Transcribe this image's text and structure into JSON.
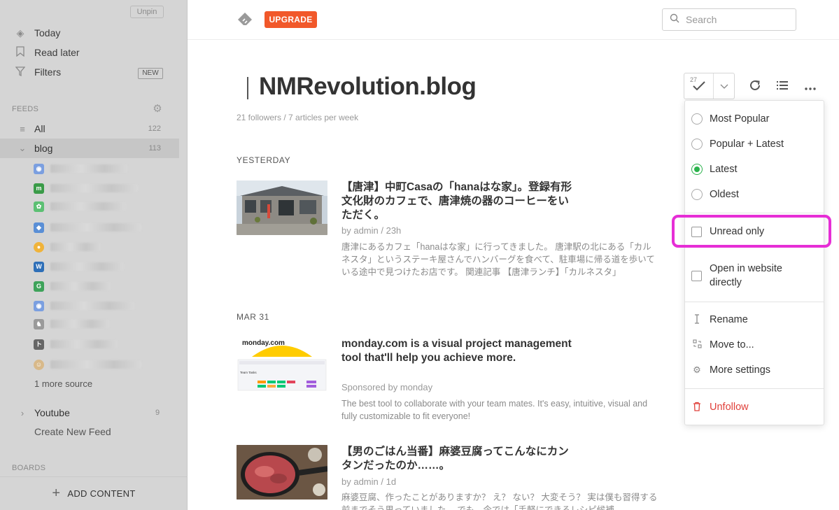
{
  "sidebar": {
    "unpin_label": "Unpin",
    "today": "Today",
    "read_later": "Read later",
    "filters": "Filters",
    "filters_badge": "NEW",
    "feeds_header": "FEEDS",
    "all_label": "All",
    "all_count": "122",
    "blog_label": "blog",
    "blog_count": "113",
    "more_source": "1 more source",
    "youtube_label": "Youtube",
    "youtube_count": "9",
    "create_feed": "Create New Feed",
    "boards_header": "BOARDS",
    "add_content": "ADD CONTENT"
  },
  "header": {
    "upgrade_label": "UPGRADE",
    "search_placeholder": "Search"
  },
  "feed": {
    "title": "NMRevolution.blog",
    "subtitle": "21 followers / 7 articles per week",
    "unread_count": "27"
  },
  "sections": {
    "yesterday": "YESTERDAY",
    "mar31": "MAR 31"
  },
  "articles": [
    {
      "title": "【唐津】中町Casaの「hanaはな家」。登録有形文化財のカフェで、唐津焼の器のコーヒーをいただく。",
      "meta": "by admin / 23h",
      "summary": "唐津にあるカフェ「hanaはな家」に行ってきました。 唐津駅の北にある「カルネスタ」というステーキ屋さんでハンバーグを食べて、駐車場に帰る道を歩いている途中で見つけたお店です。 関連記事 【唐津ランチ】「カルネスタ」"
    },
    {
      "title": "monday.com is a visual project management tool that'll help you achieve more.",
      "meta": "Sponsored by monday",
      "summary": "The best tool to collaborate with your team mates. It's easy, intuitive, visual and fully customizable to fit everyone!"
    },
    {
      "title": "【男のごはん当番】麻婆豆腐ってこんなにカンタンだったのか……。",
      "meta": "by admin / 1d",
      "summary": "麻婆豆腐、作ったことがありますか？ え？ ない？ 大変そう？ 実は僕も習得する前までそう思っていました。 でも、今では「手軽にできるレシピ候補"
    }
  ],
  "dropdown": {
    "sort_options": [
      "Most Popular",
      "Popular + Latest",
      "Latest",
      "Oldest"
    ],
    "selected_sort": "Latest",
    "unread_only": "Unread only",
    "open_website": "Open in website directly",
    "rename": "Rename",
    "move_to": "Move to...",
    "more_settings": "More settings",
    "unfollow": "Unfollow"
  },
  "colors": {
    "accent": "#f1582a",
    "selected_radio": "#2bb24c",
    "highlight": "#e62ed6",
    "unfollow": "#e0403a"
  }
}
